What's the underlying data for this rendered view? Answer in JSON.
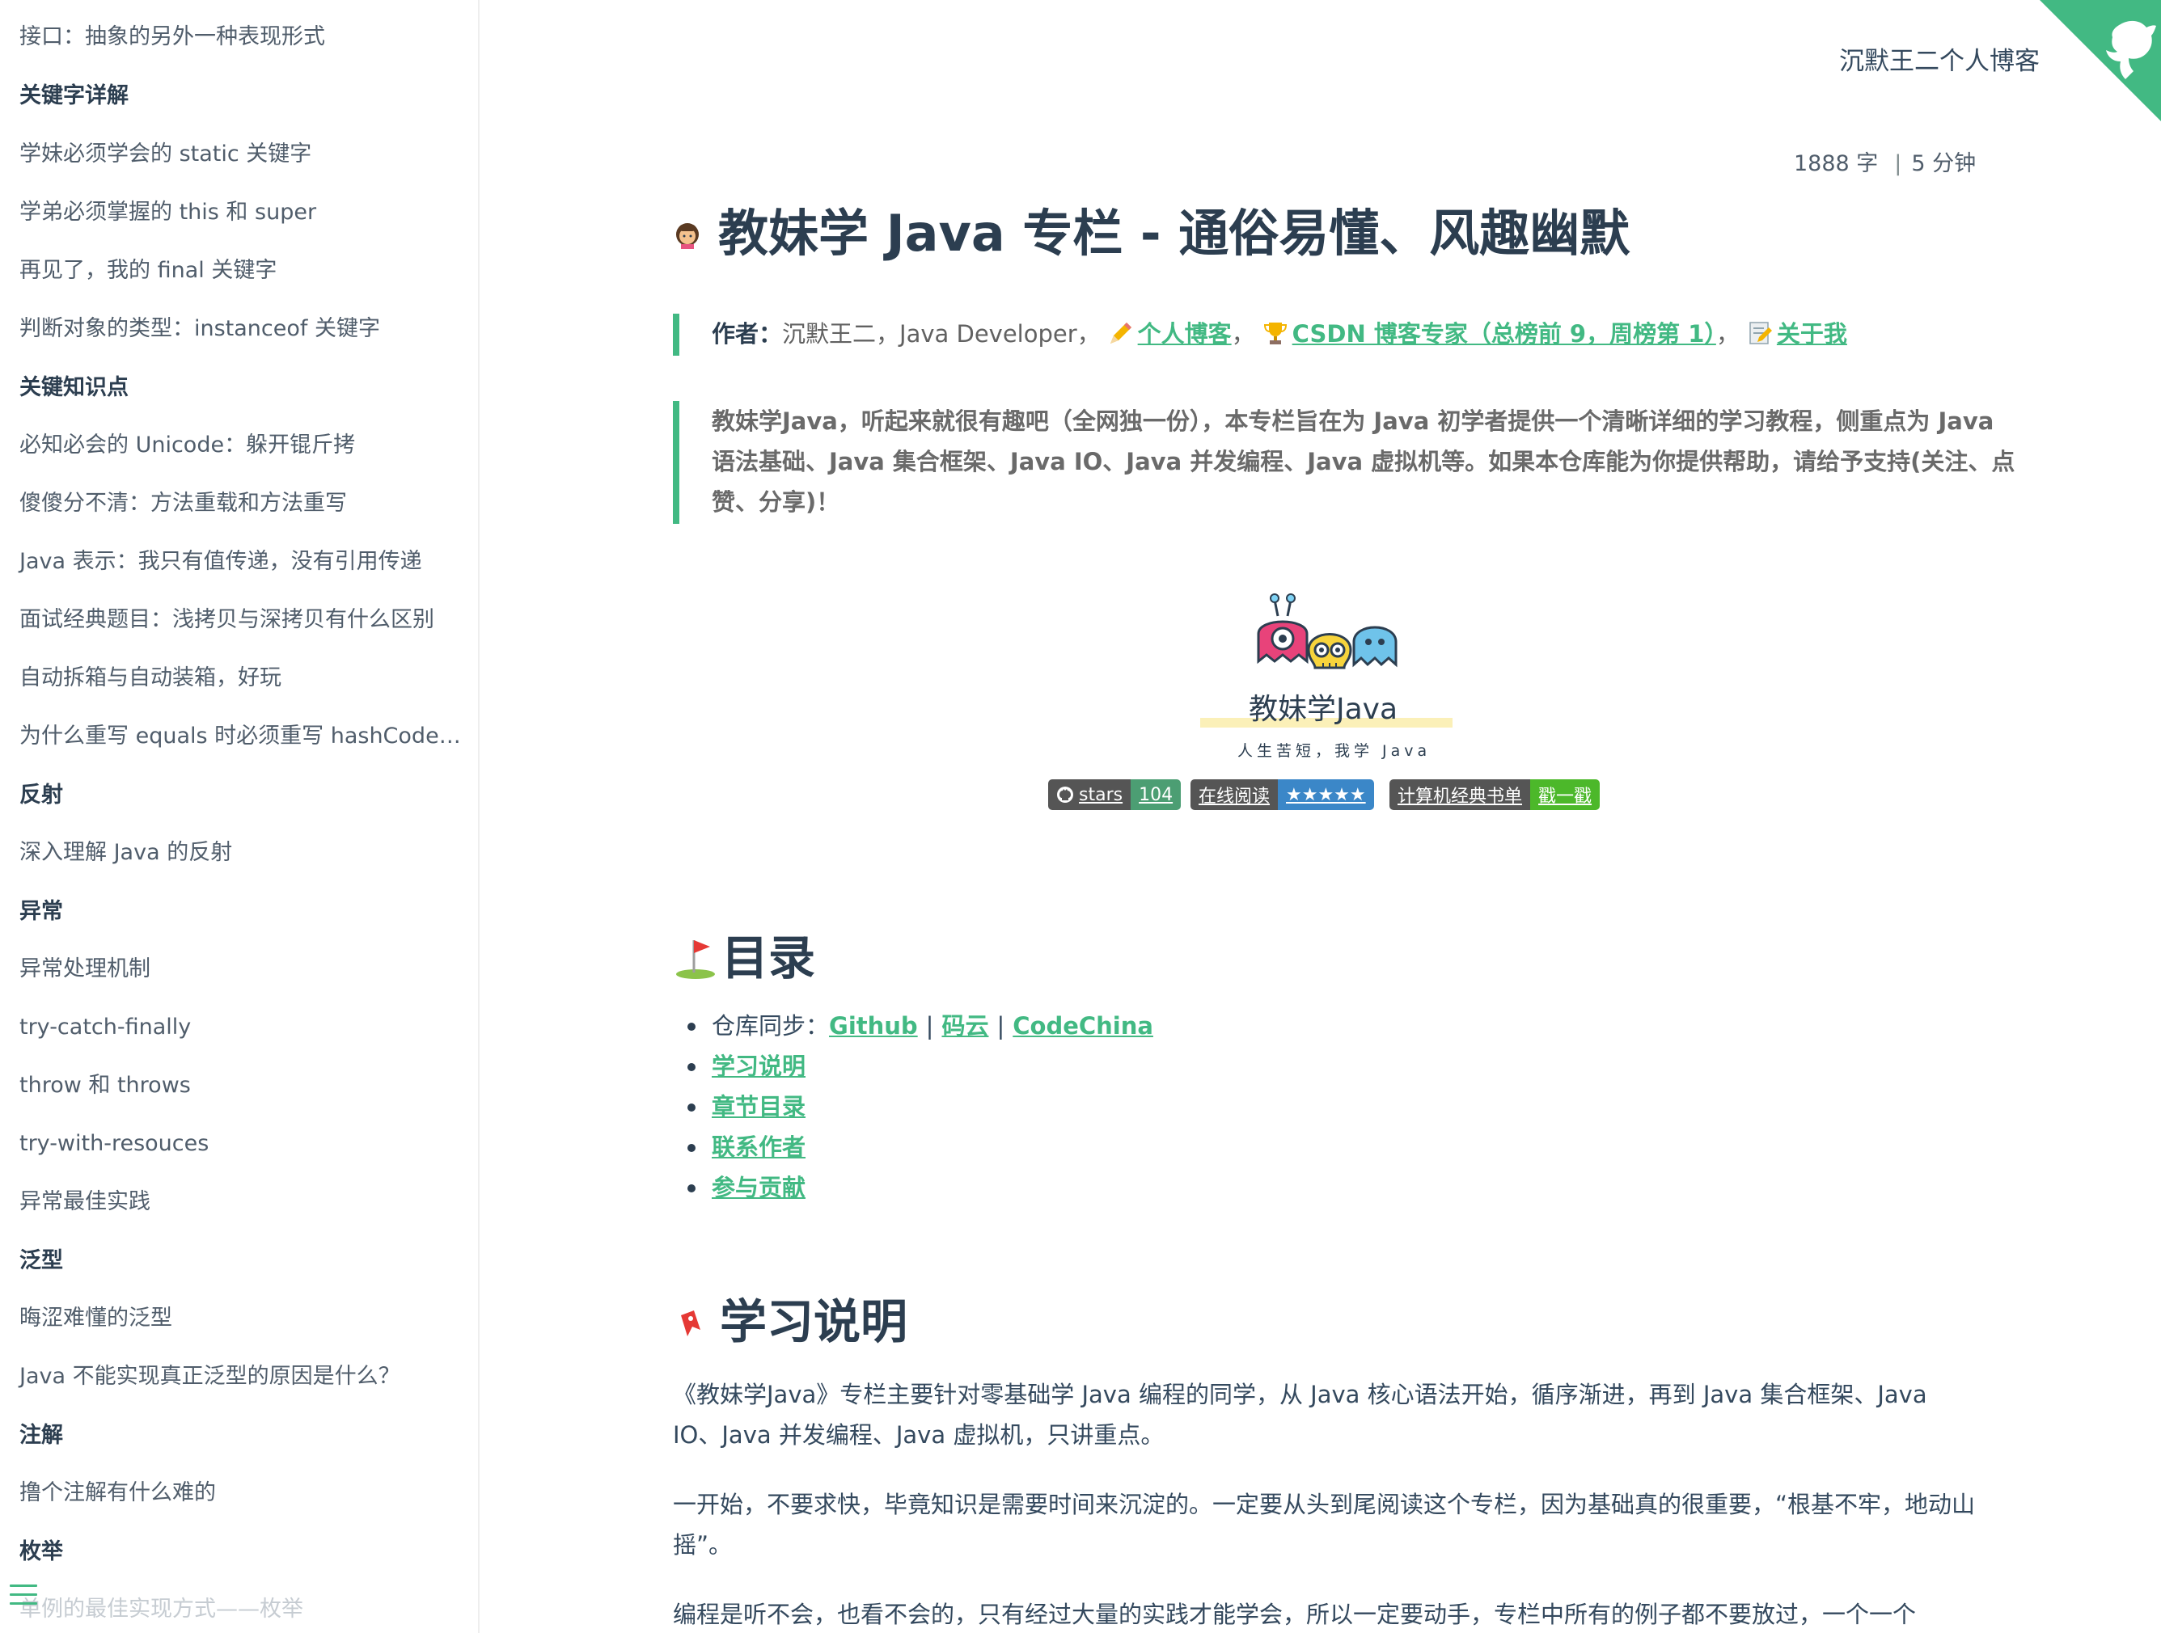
{
  "sidebar": {
    "items": [
      {
        "label": "接口：抽象的另外一种表现形式",
        "type": "item"
      },
      {
        "label": "关键字详解",
        "type": "head"
      },
      {
        "label": "学妹必须学会的 static 关键字",
        "type": "item"
      },
      {
        "label": "学弟必须掌握的 this 和 super",
        "type": "item"
      },
      {
        "label": "再见了，我的 final 关键字",
        "type": "item"
      },
      {
        "label": "判断对象的类型：instanceof 关键字",
        "type": "item"
      },
      {
        "label": "关键知识点",
        "type": "head"
      },
      {
        "label": "必知必会的 Unicode：躲开锟斤拷",
        "type": "item"
      },
      {
        "label": "傻傻分不清：方法重载和方法重写",
        "type": "item"
      },
      {
        "label": "Java 表示：我只有值传递，没有引用传递",
        "type": "item"
      },
      {
        "label": "面试经典题目：浅拷贝与深拷贝有什么区别",
        "type": "item"
      },
      {
        "label": "自动拆箱与自动装箱，好玩",
        "type": "item"
      },
      {
        "label": "为什么重写 equals 时必须重写 hashCode 方法",
        "type": "item"
      },
      {
        "label": "反射",
        "type": "head"
      },
      {
        "label": "深入理解 Java 的反射",
        "type": "item"
      },
      {
        "label": "异常",
        "type": "head"
      },
      {
        "label": "异常处理机制",
        "type": "item"
      },
      {
        "label": "try-catch-finally",
        "type": "item"
      },
      {
        "label": "throw 和 throws",
        "type": "item"
      },
      {
        "label": "try-with-resouces",
        "type": "item"
      },
      {
        "label": "异常最佳实践",
        "type": "item"
      },
      {
        "label": "泛型",
        "type": "head"
      },
      {
        "label": "晦涩难懂的泛型",
        "type": "item"
      },
      {
        "label": "Java 不能实现真正泛型的原因是什么？",
        "type": "item"
      },
      {
        "label": "注解",
        "type": "head"
      },
      {
        "label": "撸个注解有什么难的",
        "type": "item"
      },
      {
        "label": "枚举",
        "type": "head"
      },
      {
        "label": "单例的最佳实现方式——枚举",
        "type": "item"
      }
    ]
  },
  "nav": {
    "title": "沉默王二个人博客"
  },
  "meta": {
    "words": "1888 字",
    "time": "5 分钟"
  },
  "page": {
    "title": "教妹学 Java 专栏 - 通俗易懂、风趣幽默"
  },
  "author": {
    "label": "作者：",
    "text": "沉默王二，Java Developer，",
    "blog_link": "个人博客",
    "csdn_link": "CSDN 博客专家（总榜前 9，周榜第 1）",
    "about_link": "关于我",
    "sep": "，"
  },
  "intro": "教妹学Java，听起来就很有趣吧（全网独一份），本专栏旨在为 Java 初学者提供一个清晰详细的学习教程，侧重点为 Java 语法基础、Java 集合框架、Java IO、Java 并发编程、Java 虚拟机等。如果本仓库能为你提供帮助，请给予支持(关注、点赞、分享)！",
  "logo": {
    "title": "教妹学Java",
    "subtitle": "人生苦短，我学 Java"
  },
  "badges": [
    {
      "left": "stars",
      "right": "104"
    },
    {
      "left": "在线阅读",
      "right": "★★★★★"
    },
    {
      "left": "计算机经典书单",
      "right": "戳一戳"
    }
  ],
  "toc": {
    "heading": "目录",
    "sync_label": "仓库同步：",
    "github": "Github",
    "gitee": "码云",
    "codechina": "CodeChina",
    "pipe": "|",
    "links": [
      "学习说明",
      "章节目录",
      "联系作者",
      "参与贡献"
    ]
  },
  "learn": {
    "heading": "学习说明",
    "p1": "《教妹学Java》专栏主要针对零基础学 Java 编程的同学，从 Java 核心语法开始，循序渐进，再到 Java 集合框架、Java IO、Java 并发编程、Java 虚拟机，只讲重点。",
    "p2": "一开始，不要求快，毕竟知识是需要时间来沉淀的。一定要从头到尾阅读这个专栏，因为基础真的很重要，“根基不牢，地动山摇”。",
    "p3": "编程是听不会，也看不会的，只有经过大量的实践才能学会，所以一定要动手，专栏中所有的例子都不要放过，一个一个"
  },
  "colors": {
    "accent": "#42b983",
    "text": "#34495e",
    "heading": "#2c3e50"
  }
}
